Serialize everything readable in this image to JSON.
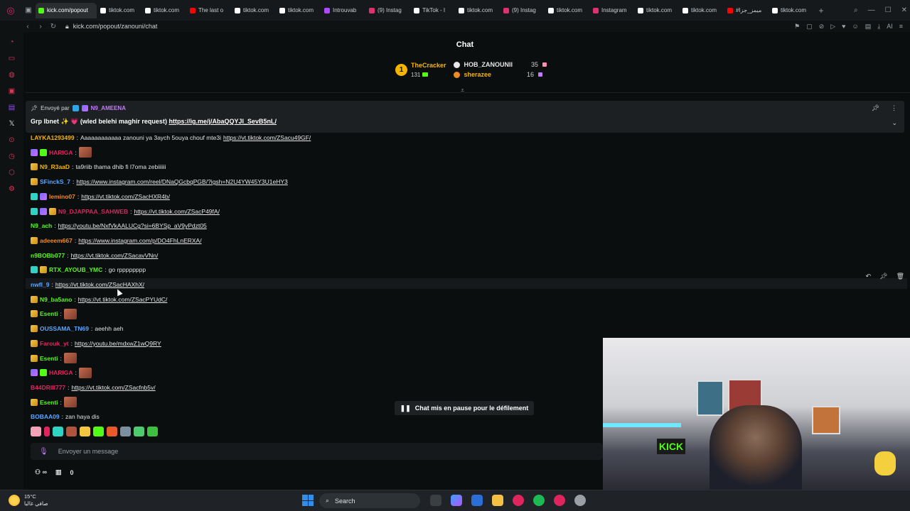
{
  "browser": {
    "tabs": [
      {
        "label": "kick.com/popout",
        "active": true,
        "color": "#53fc18"
      },
      {
        "label": "tiktok.com",
        "color": "#ffffff"
      },
      {
        "label": "tiktok.com",
        "color": "#ffffff"
      },
      {
        "label": "The last o",
        "color": "#ff0000"
      },
      {
        "label": "tiktok.com",
        "color": "#ffffff"
      },
      {
        "label": "tiktok.com",
        "color": "#ffffff"
      },
      {
        "label": "Introuvab",
        "color": "#b048ff"
      },
      {
        "label": "(9) Instag",
        "color": "#e1306c"
      },
      {
        "label": "TikTok - I",
        "color": "#ffffff"
      },
      {
        "label": "tiktok.com",
        "color": "#ffffff"
      },
      {
        "label": "(9) Instag",
        "color": "#e1306c"
      },
      {
        "label": "tiktok.com",
        "color": "#ffffff"
      },
      {
        "label": "Instagram",
        "color": "#e1306c"
      },
      {
        "label": "tiktok.com",
        "color": "#ffffff"
      },
      {
        "label": "tiktok.com",
        "color": "#ffffff"
      },
      {
        "label": "#ميمز_جزا",
        "color": "#ff0000"
      },
      {
        "label": "tiktok.com",
        "color": "#ffffff"
      }
    ],
    "url": "kick.com/popout/zanouni/chat",
    "ai_label": "AI"
  },
  "chat": {
    "title": "Chat",
    "leaderboard": {
      "top_name": "TheCracker",
      "top_count": "131",
      "rows": [
        {
          "name": "HOB_ZANOUNII",
          "count": "35"
        },
        {
          "name": "sherazee",
          "count": "16"
        }
      ]
    },
    "pinned": {
      "sent_by_label": "Envoyé par",
      "sender": "N9_AMEENA",
      "text": "Grp lbnet ✨ 💗 (wled belehi maghir request)",
      "link": "https://ig.me/j/AbaQQYJl_SevB5nL/"
    },
    "messages": [
      {
        "user": "LAYKA1293499",
        "color": "#f5b400",
        "badges": [],
        "text": "Aaaaaaaaaaaa zanouni ya 3aych 5ouya chouf mte3i",
        "link": "https://vt.tiktok.com/ZSacu49GF/"
      },
      {
        "user": "HARIGA",
        "color": "#e0245e",
        "badges": [
          "gift",
          "sub"
        ],
        "text": "",
        "link": "",
        "emote": true
      },
      {
        "user": "N9_R3aaD",
        "color": "#f5b400",
        "badges": [
          "yel"
        ],
        "text": "ta9riib thama dhib fi l7oma zebiiiiii",
        "link": ""
      },
      {
        "user": "SFinckS_7",
        "color": "#5aa7ff",
        "badges": [
          "yel"
        ],
        "text": "",
        "link": "https://www.instagram.com/reel/DNaQGcbqPGB/?igsh=N2U4YW45Y3U1eHY3"
      },
      {
        "user": "lemino07",
        "color": "#f08a24",
        "badges": [
          "cyan",
          "gift"
        ],
        "text": "",
        "link": "https://vt.tiktok.com/ZSacHXR4b/"
      },
      {
        "user": "N9_DJAPPAA_SAHWEB",
        "color": "#e0245e",
        "badges": [
          "cyan",
          "gift",
          "yel"
        ],
        "text": "",
        "link": "https://vt.tiktok.com/ZSacP49fA/"
      },
      {
        "user": "N9_ach",
        "color": "#53fc18",
        "badges": [],
        "text": "",
        "link": "https://youtu.be/NxfVkAALUCg?si=6BYSp_aV9yPdzt05"
      },
      {
        "user": "adeeem667",
        "color": "#f08a24",
        "badges": [
          "yel"
        ],
        "text": "",
        "link": "https://www.instagram.com/p/DO4FhLnERXA/"
      },
      {
        "user": "n9BOBb077",
        "color": "#53fc18",
        "badges": [],
        "text": "",
        "link": "https://vt.tiktok.com/ZSacavVNn/"
      },
      {
        "user": "RTX_AYOUB_YMC",
        "color": "#53fc18",
        "badges": [
          "cyan",
          "yel"
        ],
        "text": "go rpppppppp",
        "link": ""
      },
      {
        "user": "nwfl_9",
        "color": "#5aa7ff",
        "badges": [],
        "text": "",
        "link": "https://vt.tiktok.com/ZSacHAXhX/"
      },
      {
        "user": "N9_ba5ano",
        "color": "#53fc18",
        "badges": [
          "yel"
        ],
        "text": "",
        "link": "https://vt.tiktok.com/ZSacPYUdC/"
      },
      {
        "user": "Esenti",
        "color": "#53fc18",
        "badges": [
          "yel"
        ],
        "text": "",
        "link": "",
        "emote": true
      },
      {
        "user": "OUSSAMA_TN69",
        "color": "#5aa7ff",
        "badges": [
          "yel"
        ],
        "text": "aeehh aeh",
        "link": ""
      },
      {
        "user": "Farouk_yt",
        "color": "#e0245e",
        "badges": [
          "yel"
        ],
        "text": "",
        "link": "https://youtu.be/mdxwZ1wQ9RY"
      },
      {
        "user": "Esenti",
        "color": "#53fc18",
        "badges": [
          "yel"
        ],
        "text": "",
        "link": "",
        "emote": true
      },
      {
        "user": "HARIGA",
        "color": "#e0245e",
        "badges": [
          "gift",
          "sub"
        ],
        "text": "",
        "link": "",
        "emote": true
      },
      {
        "user": "B44DRIII777",
        "color": "#e0245e",
        "badges": [],
        "text": "",
        "link": "https://vt.tiktok.com/ZSacfnb5v/"
      },
      {
        "user": "Esenti",
        "color": "#53fc18",
        "badges": [
          "yel"
        ],
        "text": "",
        "link": "",
        "emote": true
      },
      {
        "user": "BOBAA09",
        "color": "#5aa7ff",
        "badges": [],
        "text": "zan haya dis",
        "link": ""
      }
    ],
    "paused_label": "Chat mis en pause pour le défilement",
    "input_placeholder": "Envoyer un message",
    "points_count": "0"
  },
  "taskbar": {
    "temperature": "15°C",
    "weather_desc": "صافي غالبا",
    "search_label": "Search"
  },
  "colors": {
    "accent": "#53fc18",
    "background": "#0b0e0f"
  }
}
